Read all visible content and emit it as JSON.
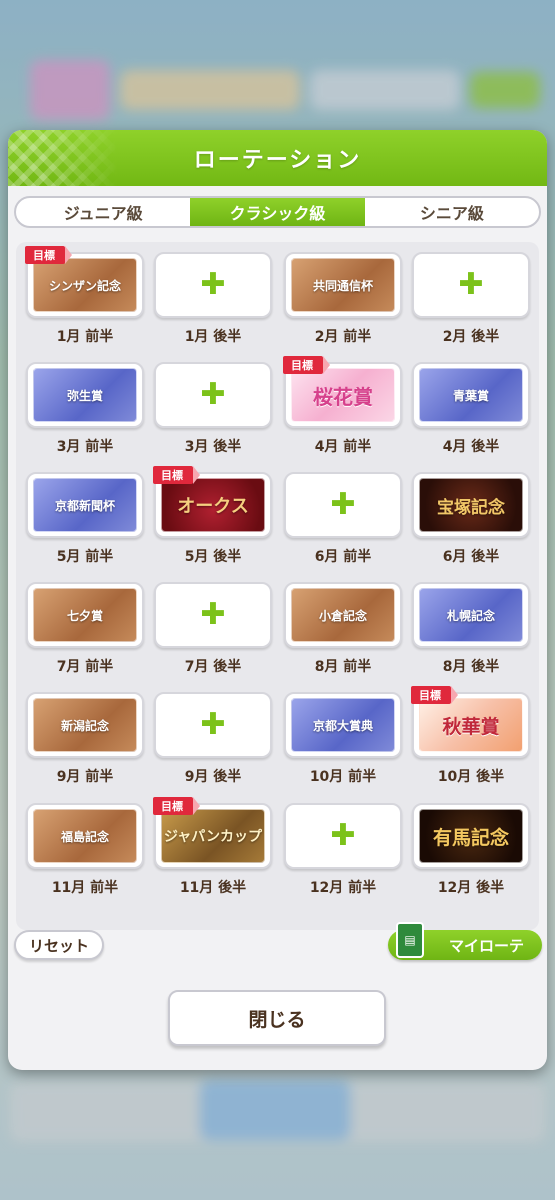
{
  "dialog": {
    "title": "ローテーション",
    "tabs": [
      {
        "label": "ジュニア級",
        "active": false
      },
      {
        "label": "クラシック級",
        "active": true
      },
      {
        "label": "シニア級",
        "active": false
      }
    ],
    "slots": [
      {
        "label": "1月 前半",
        "race": "シンザン記念",
        "style": "bronze",
        "goal": true
      },
      {
        "label": "1月 後半",
        "race": null,
        "style": "empty",
        "goal": false
      },
      {
        "label": "2月 前半",
        "race": "共同通信杯",
        "style": "bronze",
        "goal": false
      },
      {
        "label": "2月 後半",
        "race": null,
        "style": "empty",
        "goal": false
      },
      {
        "label": "3月 前半",
        "race": "弥生賞",
        "style": "blue",
        "goal": false
      },
      {
        "label": "3月 後半",
        "race": null,
        "style": "empty",
        "goal": false
      },
      {
        "label": "4月 前半",
        "race": "桜花賞",
        "style": "sakura",
        "goal": true
      },
      {
        "label": "4月 後半",
        "race": "青葉賞",
        "style": "blue",
        "goal": false
      },
      {
        "label": "5月 前半",
        "race": "京都新聞杯",
        "style": "blue",
        "goal": false
      },
      {
        "label": "5月 後半",
        "race": "オークス",
        "style": "oaks",
        "goal": true
      },
      {
        "label": "6月 前半",
        "race": null,
        "style": "empty",
        "goal": false
      },
      {
        "label": "6月 後半",
        "race": "宝塚記念",
        "style": "takarazuka",
        "goal": false
      },
      {
        "label": "7月 前半",
        "race": "七夕賞",
        "style": "bronze",
        "goal": false
      },
      {
        "label": "7月 後半",
        "race": null,
        "style": "empty",
        "goal": false
      },
      {
        "label": "8月 前半",
        "race": "小倉記念",
        "style": "bronze",
        "goal": false
      },
      {
        "label": "8月 後半",
        "race": "札幌記念",
        "style": "blue",
        "goal": false
      },
      {
        "label": "9月 前半",
        "race": "新潟記念",
        "style": "bronze",
        "goal": false
      },
      {
        "label": "9月 後半",
        "race": null,
        "style": "empty",
        "goal": false
      },
      {
        "label": "10月 前半",
        "race": "京都大賞典",
        "style": "blue",
        "goal": false
      },
      {
        "label": "10月 後半",
        "race": "秋華賞",
        "style": "shuka",
        "goal": true
      },
      {
        "label": "11月 前半",
        "race": "福島記念",
        "style": "bronze",
        "goal": false
      },
      {
        "label": "11月 後半",
        "race": "ジャパンカップ",
        "style": "japancup",
        "goal": true
      },
      {
        "label": "12月 前半",
        "race": null,
        "style": "empty",
        "goal": false
      },
      {
        "label": "12月 後半",
        "race": "有馬記念",
        "style": "arima",
        "goal": false
      }
    ],
    "goal_badge": "目標",
    "reset_label": "リセット",
    "my_rotation_label": "マイローテ",
    "close_label": "閉じる"
  },
  "colors": {
    "accent_green": "#7cc21a",
    "goal_red": "#e0283c",
    "label_brown": "#4a3220"
  }
}
